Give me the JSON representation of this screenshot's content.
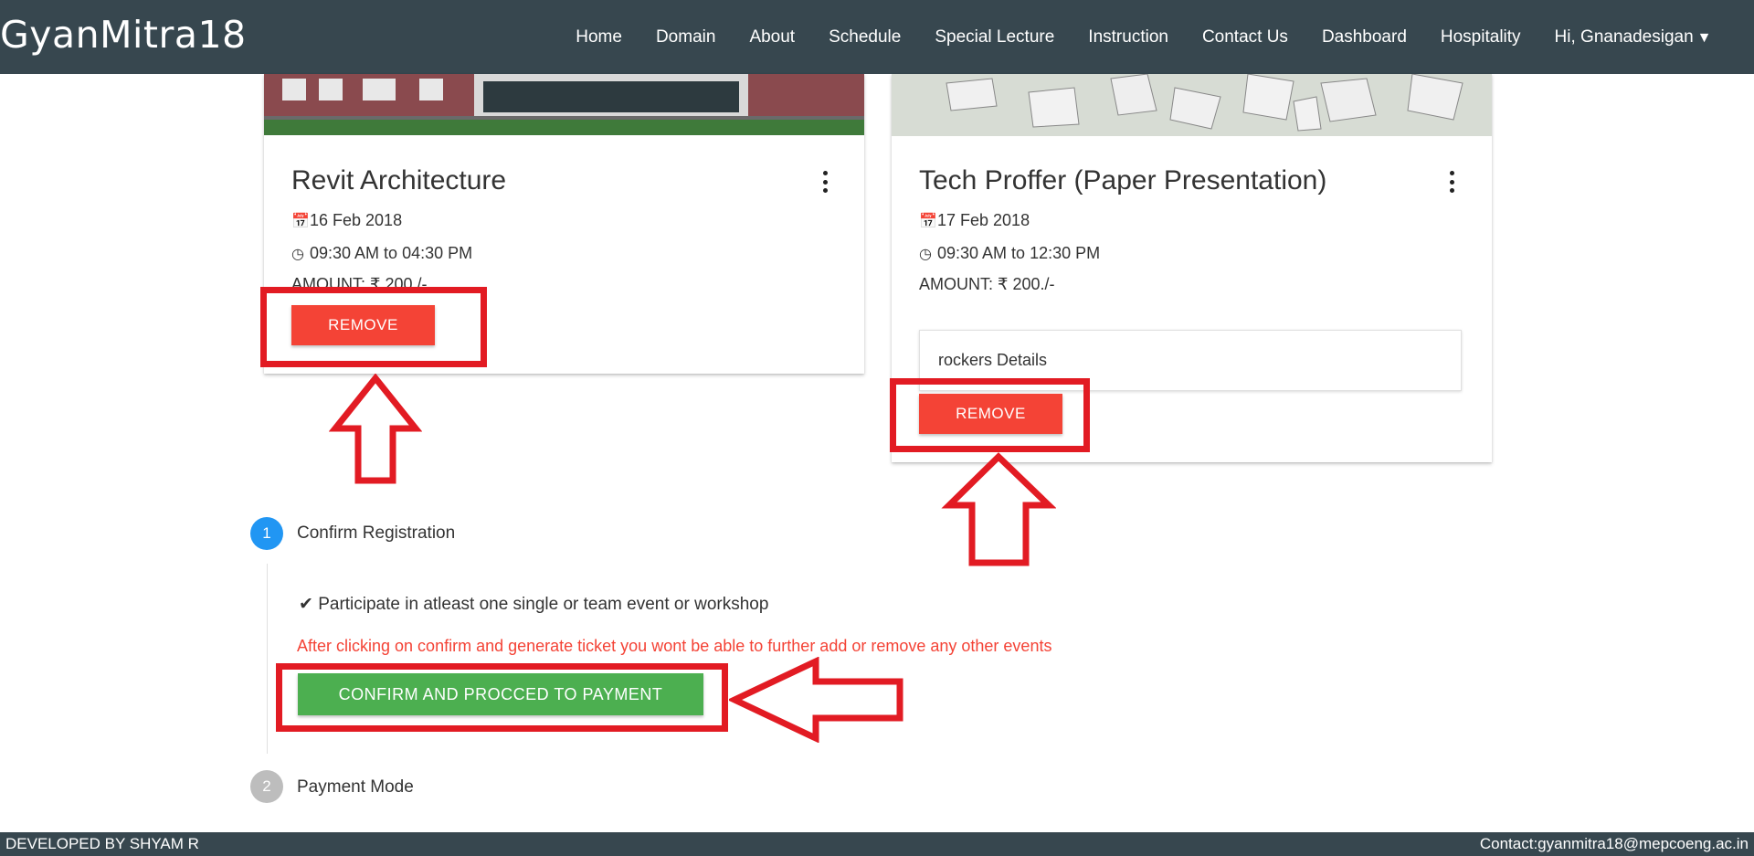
{
  "header": {
    "brand": "GyanMitra18",
    "nav": [
      "Home",
      "Domain",
      "About",
      "Schedule",
      "Special Lecture",
      "Instruction",
      "Contact Us",
      "Dashboard",
      "Hospitality",
      "Hi, Gnanadesigan"
    ],
    "user_menu_icon": "caret-down-icon"
  },
  "cards": [
    {
      "title": "Revit Architecture",
      "date": "16 Feb 2018",
      "time": "09:30 AM to 04:30 PM",
      "amount": "AMOUNT: ₹ 200./-",
      "remove_label": "REMOVE"
    },
    {
      "title": "Tech Proffer (Paper Presentation)",
      "date": "17 Feb 2018",
      "time": "09:30 AM to 12:30 PM",
      "amount": "AMOUNT: ₹ 200./-",
      "details": "rockers Details",
      "remove_label": "REMOVE"
    }
  ],
  "stepper": {
    "steps": [
      {
        "number": "1",
        "label": "Confirm Registration",
        "color": "#2196f3"
      },
      {
        "number": "2",
        "label": "Payment Mode",
        "color": "#bdbdbd"
      }
    ],
    "requirement": "Participate in atleast one single or team event or workshop",
    "warning": "After clicking on confirm and generate ticket you wont be able to further add or remove any other events",
    "confirm_label": "CONFIRM AND PROCCED TO PAYMENT"
  },
  "footer": {
    "developer": "DEVELOPED BY SHYAM R",
    "contact": "Contact:gyanmitra18@mepcoeng.ac.in"
  },
  "colors": {
    "header_bg": "#37474f",
    "remove": "#f44336",
    "confirm": "#4caf50",
    "annotation": "#e21b23",
    "step_active": "#2196f3",
    "step_inactive": "#bdbdbd"
  }
}
